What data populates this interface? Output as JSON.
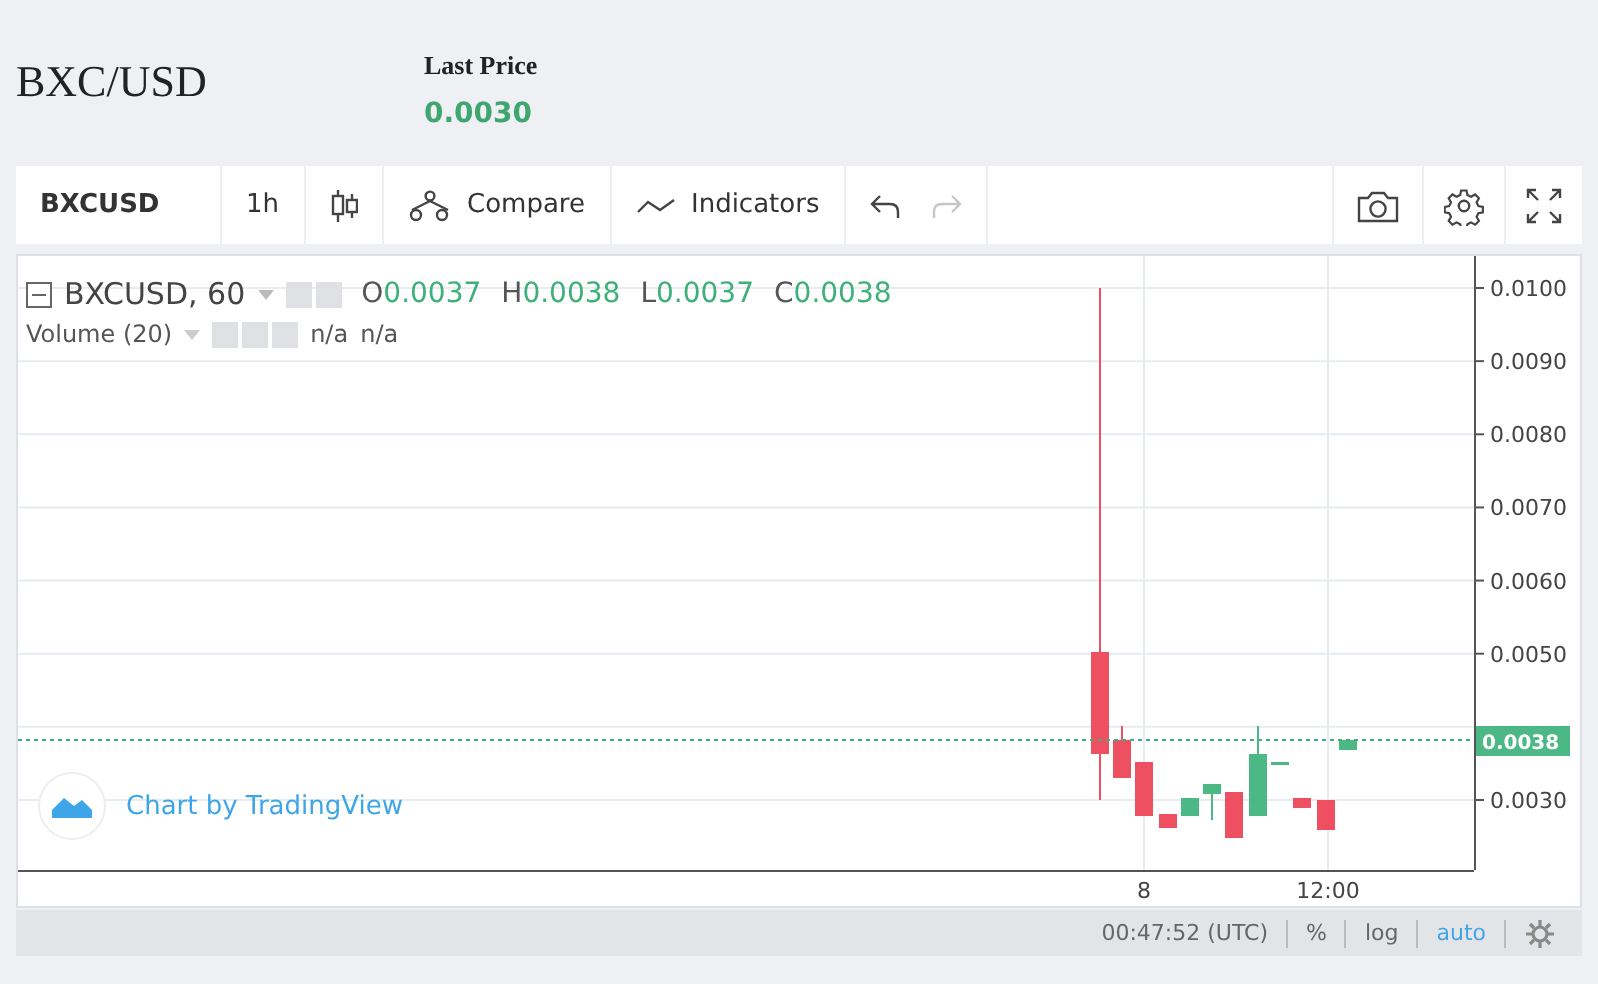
{
  "pair": "BXC/USD",
  "last_price": {
    "label": "Last Price",
    "value": "0.0030"
  },
  "toolbar": {
    "symbol": "BXCUSD",
    "interval": "1h",
    "compare": "Compare",
    "indicators": "Indicators",
    "redo_disabled": true
  },
  "legend": {
    "series": "BXCUSD, 60",
    "ohlc": [
      {
        "key": "O",
        "value": "0.0037"
      },
      {
        "key": "H",
        "value": "0.0038"
      },
      {
        "key": "L",
        "value": "0.0037"
      },
      {
        "key": "C",
        "value": "0.0038"
      }
    ],
    "volume": "Volume (20)",
    "volume_values": [
      "n/a",
      "n/a"
    ]
  },
  "price_axis": [
    "0.0100",
    "0.0090",
    "0.0080",
    "0.0070",
    "0.0060",
    "0.0050",
    "0.0030"
  ],
  "last_price_label": "0.0038",
  "time_axis": [
    "8",
    "12:00"
  ],
  "branding": "Chart by TradingView",
  "status_bar": {
    "time": "00:47:52 (UTC)",
    "toggles": [
      {
        "label": "%",
        "selected": false
      },
      {
        "label": "log",
        "selected": false
      },
      {
        "label": "auto",
        "selected": true
      }
    ]
  }
}
